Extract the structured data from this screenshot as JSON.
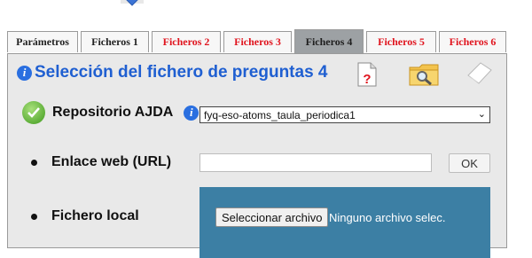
{
  "tabs": [
    {
      "label": "Parámetros",
      "color": "normal"
    },
    {
      "label": "Ficheros 1",
      "color": "normal"
    },
    {
      "label": "Ficheros 2",
      "color": "red"
    },
    {
      "label": "Ficheros 3",
      "color": "red"
    },
    {
      "label": "Ficheros 4",
      "color": "active"
    },
    {
      "label": "Ficheros 5",
      "color": "red"
    },
    {
      "label": "Ficheros 6",
      "color": "red"
    }
  ],
  "panel": {
    "title": "Selección del fichero de preguntas 4",
    "tools": [
      "help-document-icon",
      "search-folder-icon",
      "eraser-icon"
    ]
  },
  "repository": {
    "label": "Repositorio AJDA",
    "selected": "fyq-eso-atoms_taula_periodica1"
  },
  "url_row": {
    "label": "Enlace web (URL)",
    "value": "",
    "ok_label": "OK"
  },
  "file_row": {
    "label": "Fichero local",
    "button_label": "Seleccionar archivo",
    "status": "Ninguno archivo selec."
  },
  "colors": {
    "title_blue": "#1f5fd1",
    "tab_red": "#e0141e",
    "active_tab": "#9da1a4",
    "file_box": "#3c7fa4"
  }
}
